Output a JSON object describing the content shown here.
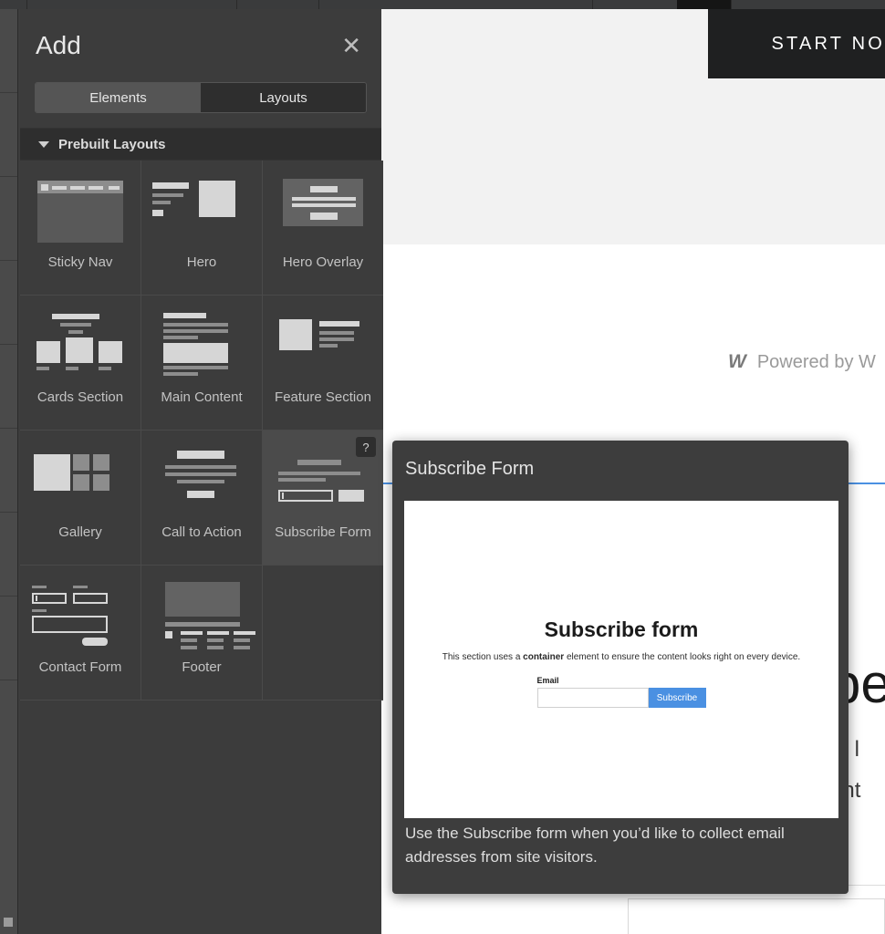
{
  "panel": {
    "title": "Add",
    "close_icon": "close-icon",
    "tabs": [
      {
        "label": "Elements",
        "active": true
      },
      {
        "label": "Layouts",
        "active": false
      }
    ],
    "section": {
      "caret_icon": "chevron-down-icon",
      "title": "Prebuilt Layouts"
    },
    "layouts": [
      {
        "label": "Sticky Nav",
        "thumb": "sticky-nav",
        "hover": false,
        "badge": ""
      },
      {
        "label": "Hero",
        "thumb": "hero",
        "hover": false,
        "badge": ""
      },
      {
        "label": "Hero Overlay",
        "thumb": "hero-overlay",
        "hover": false,
        "badge": ""
      },
      {
        "label": "Cards Section",
        "thumb": "cards-section",
        "hover": false,
        "badge": ""
      },
      {
        "label": "Main Content",
        "thumb": "main-content",
        "hover": false,
        "badge": ""
      },
      {
        "label": "Feature Section",
        "thumb": "feature-section",
        "hover": false,
        "badge": ""
      },
      {
        "label": "Gallery",
        "thumb": "gallery",
        "hover": false,
        "badge": ""
      },
      {
        "label": "Call to Action",
        "thumb": "call-to-action",
        "hover": false,
        "badge": ""
      },
      {
        "label": "Subscribe Form",
        "thumb": "subscribe-form",
        "hover": true,
        "badge": "?"
      },
      {
        "label": "Contact Form",
        "thumb": "contact-form",
        "hover": false,
        "badge": ""
      },
      {
        "label": "Footer",
        "thumb": "footer",
        "hover": false,
        "badge": ""
      }
    ]
  },
  "popover": {
    "title": "Subscribe Form",
    "description": "Use the Subscribe form when you’d like to collect email addresses from site visitors.",
    "preview": {
      "heading": "Subscribe form",
      "body_before": "This section uses a ",
      "body_bold": "container",
      "body_after": " element to ensure the content looks right on every device.",
      "field_label": "Email",
      "field_value": "",
      "field_placeholder": "",
      "submit_label": "Subscribe"
    }
  },
  "canvas": {
    "nav_cta": "START NO",
    "powered_logo": "webflow-w-logo",
    "powered_text": "Powered by W",
    "heading_fragment": "be",
    "sub_line_1": "nt l",
    "sub_line_2": "ont"
  },
  "colors": {
    "panel_bg": "#3c3c3c",
    "panel_hover": "#4b4b4b",
    "section_bg": "#2e2e2e",
    "accent_blue": "#4a90e2",
    "nav_dark": "#1f2021",
    "text_light": "#d8d8d8"
  }
}
